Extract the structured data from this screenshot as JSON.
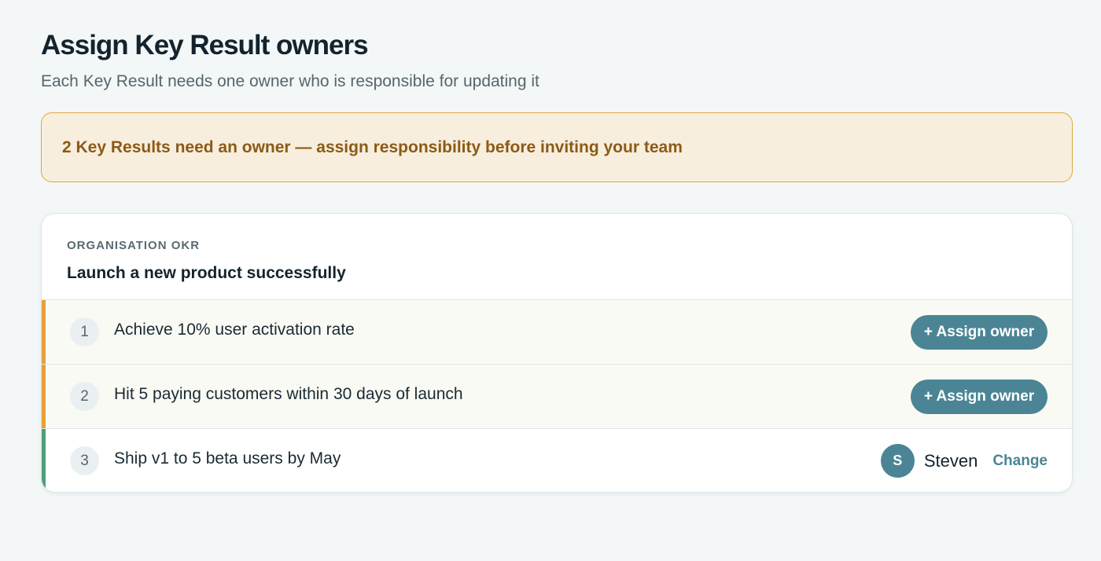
{
  "header": {
    "title": "Assign Key Result owners",
    "subtitle": "Each Key Result needs one owner who is responsible for updating it"
  },
  "alert": {
    "text": "2 Key Results need an owner — assign responsibility before inviting your team"
  },
  "okr": {
    "label": "ORGANISATION OKR",
    "title": "Launch a new product successfully",
    "key_results": [
      {
        "number": "1",
        "text": "Achieve 10% user activation rate",
        "status": "unassigned",
        "action_label": "+ Assign owner"
      },
      {
        "number": "2",
        "text": "Hit 5 paying customers within 30 days of launch",
        "status": "unassigned",
        "action_label": "+ Assign owner"
      },
      {
        "number": "3",
        "text": "Ship v1 to 5 beta users by May",
        "status": "assigned",
        "owner_initial": "S",
        "owner_name": "Steven",
        "change_label": "Change"
      }
    ]
  },
  "colors": {
    "accent": "#4b8595",
    "warning": "#e3a53f",
    "success": "#4f9e76"
  }
}
